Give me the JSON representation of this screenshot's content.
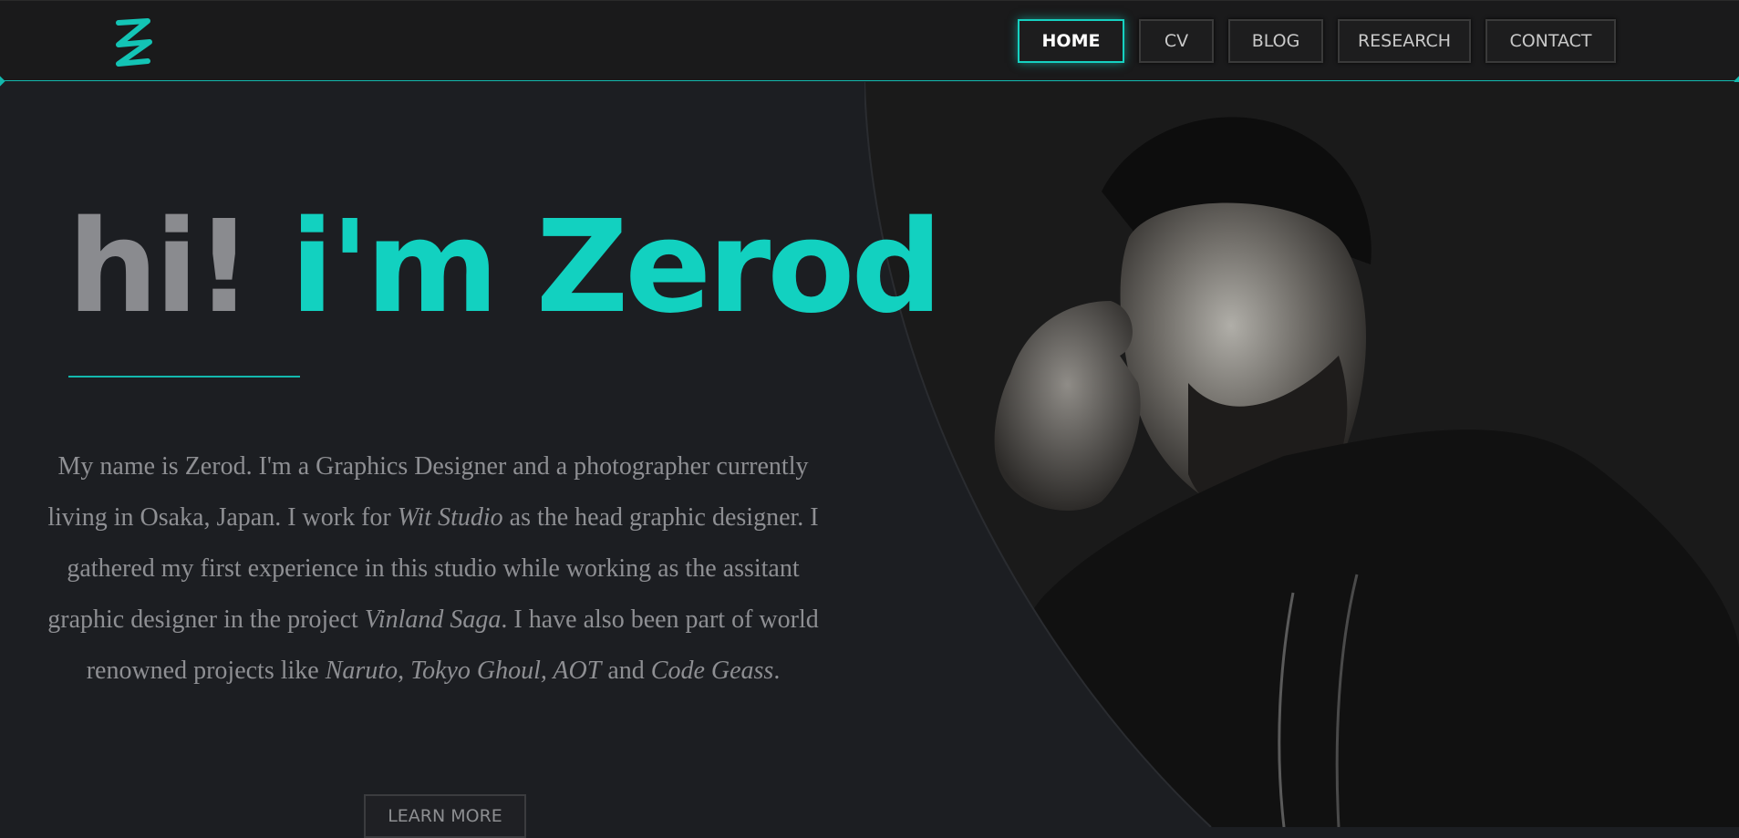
{
  "nav": {
    "logo_icon": "z-logo-icon",
    "items": [
      {
        "label": "HOME",
        "active": true
      },
      {
        "label": "CV",
        "active": false
      },
      {
        "label": "BLOG",
        "active": false
      },
      {
        "label": "RESEARCH",
        "active": false
      },
      {
        "label": "CONTACT",
        "active": false
      }
    ]
  },
  "hero": {
    "greeting": "hi!",
    "name": "i'm Zerod",
    "bio": {
      "s1": "My name is Zerod. I'm a Graphics Designer and a photographer currently living in Osaka, Japan. I work for ",
      "e1": "Wit Studio",
      "s2": " as the head graphic designer. I gathered my first experience in this studio while working as the assitant graphic designer in the project ",
      "e2": "Vinland Saga",
      "s3": ". I have also been part of world renowned projects like ",
      "e3": "Naruto, Tokyo Ghoul, AOT",
      "s4": " and ",
      "e4": "Code Geass",
      "s5": "."
    },
    "cta_label": "LEARN MORE"
  },
  "colors": {
    "accent": "#12d1c0",
    "background": "#1c1e22",
    "navbar": "#1a1a1b",
    "muted_text": "#8e8f93"
  }
}
